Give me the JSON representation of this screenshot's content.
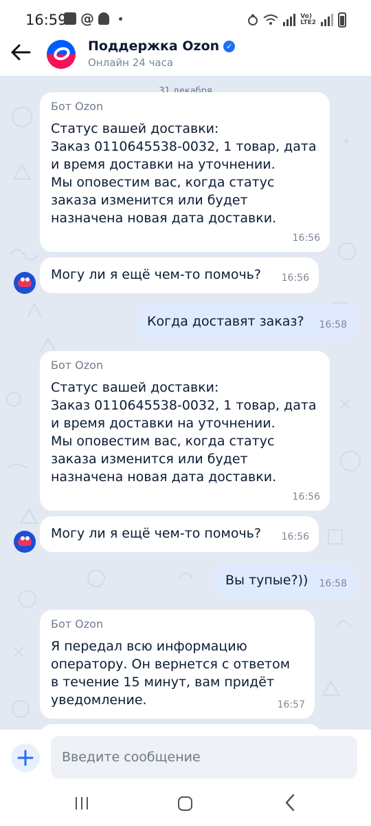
{
  "status_bar": {
    "time": "16:59",
    "left_icons": [
      "gallery-icon",
      "at-icon",
      "bell-icon",
      "dot-icon"
    ],
    "network_label_1": "Vo)",
    "network_label_2": "LTE2",
    "right_icons": [
      "alarm-icon",
      "wifi-icon",
      "signal-icon",
      "battery-icon"
    ]
  },
  "header": {
    "title": "Поддержка Ozon",
    "subtitle": "Онлайн 24 часа",
    "back_icon": "arrow-left-icon",
    "verified_icon": "verified-check-icon",
    "colors": {
      "brand_blue": "#005bff",
      "brand_pink": "#f91155"
    }
  },
  "chat": {
    "date_label": "31 декабря",
    "messages": [
      {
        "direction": "in",
        "sender": "Бот Ozon",
        "text": "Статус вашей доставки:\nЗаказ 0110645538-0032, 1 товар, дата\nи время доставки на уточнении.\nМы оповестим вас, когда статус\nзаказа изменится или будет\nназначена новая дата доставки.",
        "time": "16:56"
      },
      {
        "direction": "in",
        "text": "Могу ли я ещё чем-то помочь?",
        "time": "16:56"
      },
      {
        "direction": "out",
        "text": "Когда доставят заказ?",
        "time": "16:58"
      },
      {
        "direction": "in",
        "sender": "Бот Ozon",
        "text": "Статус вашей доставки:\nЗаказ 0110645538-0032, 1 товар, дата\nи время доставки на уточнении.\nМы оповестим вас, когда статус\nзаказа изменится или будет\nназначена новая дата доставки.",
        "time": "16:56"
      },
      {
        "direction": "in",
        "text": "Могу ли я ещё чем-то помочь?",
        "time": "16:56"
      },
      {
        "direction": "out",
        "text": "Вы тупые?))",
        "time": "16:58"
      },
      {
        "direction": "in",
        "sender": "Бот Ozon",
        "text": "Я передал всю информацию\nоператору. Он вернется с ответом\nв течение 15 минут, вам придёт\nуведомление.",
        "time": "16:57"
      }
    ],
    "colors": {
      "background": "#e3e9f3",
      "incoming": "#ffffff",
      "outgoing": "#dfeafe"
    }
  },
  "composer": {
    "placeholder": "Введите сообщение",
    "attach_icon": "plus-icon"
  },
  "nav_bar": {
    "icons": [
      "recent-apps-icon",
      "home-icon",
      "back-icon"
    ]
  }
}
